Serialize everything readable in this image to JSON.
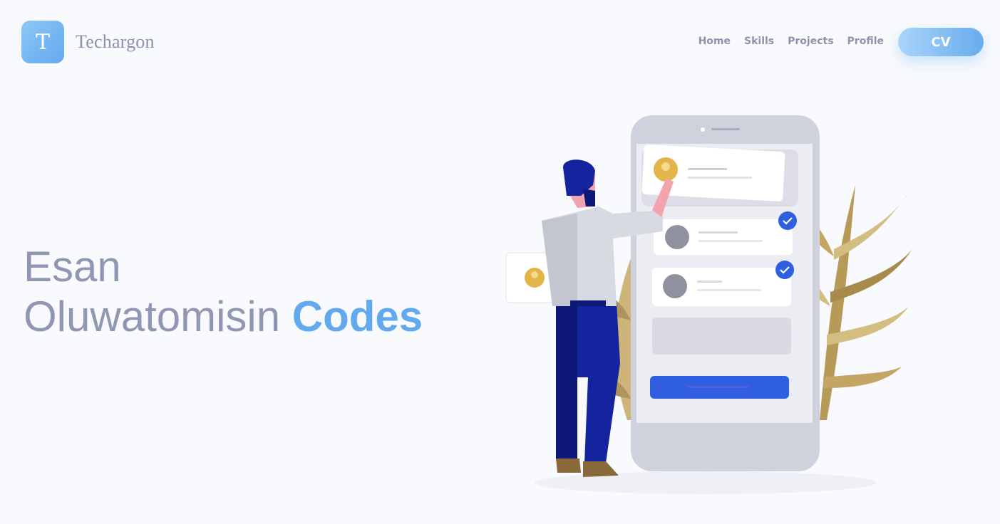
{
  "brand": {
    "logo_letter": "T",
    "name": "Techargon"
  },
  "nav": {
    "items": [
      "Home",
      "Skills",
      "Projects",
      "Profile"
    ],
    "cv_label": "CV"
  },
  "hero": {
    "line1": "Esan",
    "line2_name": "Oluwatomisin",
    "line2_accent": "Codes"
  },
  "colors": {
    "accent": "#62a9ee",
    "text_muted": "#8f98b2",
    "background": "#f8fafd"
  },
  "illustration": {
    "icon": "phone-user-illustration"
  }
}
